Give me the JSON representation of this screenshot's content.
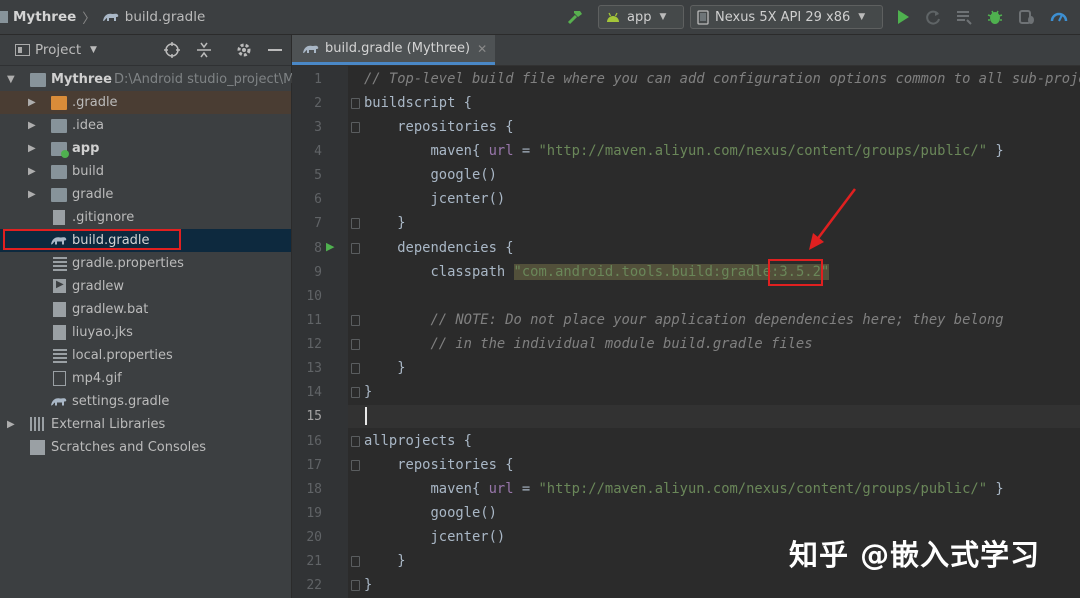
{
  "breadcrumb": {
    "project": "Mythree",
    "file": "build.gradle"
  },
  "toolbar": {
    "run_config": "app",
    "device": "Nexus 5X API 29 x86"
  },
  "project_panel": {
    "view_label": "Project",
    "root": {
      "name": "Mythree",
      "path": "D:\\Android studio_project\\M"
    },
    "items": [
      {
        "label": ".gradle"
      },
      {
        "label": ".idea"
      },
      {
        "label": "app"
      },
      {
        "label": "build"
      },
      {
        "label": "gradle"
      },
      {
        "label": ".gitignore"
      },
      {
        "label": "build.gradle"
      },
      {
        "label": "gradle.properties"
      },
      {
        "label": "gradlew"
      },
      {
        "label": "gradlew.bat"
      },
      {
        "label": "liuyao.jks"
      },
      {
        "label": "local.properties"
      },
      {
        "label": "mp4.gif"
      },
      {
        "label": "settings.gradle"
      }
    ],
    "external_libraries": "External Libraries",
    "scratches": "Scratches and Consoles"
  },
  "editor": {
    "tab_label": "build.gradle (Mythree)",
    "line_numbers": [
      "1",
      "2",
      "3",
      "4",
      "5",
      "6",
      "7",
      "8",
      "9",
      "10",
      "11",
      "12",
      "13",
      "14",
      "15",
      "16",
      "17",
      "18",
      "19",
      "20",
      "21",
      "22"
    ],
    "lines": {
      "l1": "// Top-level build file where you can add configuration options common to all sub-projec",
      "l2": "buildscript {",
      "l3": "    repositories {",
      "l4a": "        maven{ ",
      "l4b": "url",
      "l4c": " = ",
      "l4d": "\"http://maven.aliyun.com/nexus/content/groups/public/\"",
      "l4e": " }",
      "l5": "        google()",
      "l6": "        jcenter()",
      "l7": "    }",
      "l8": "    dependencies {",
      "l9a": "        classpath ",
      "l9b": "\"com.android.tools.build:gradle:3.5.2\"",
      "l11": "        // NOTE: Do not place your application dependencies here; they belong",
      "l12": "        // in the individual module build.gradle files",
      "l13": "    }",
      "l14": "}",
      "l16": "allprojects {",
      "l17": "    repositories {",
      "l18a": "        maven{ ",
      "l18b": "url",
      "l18c": " = ",
      "l18d": "\"http://maven.aliyun.com/nexus/content/groups/public/\"",
      "l18e": " }",
      "l19": "        google()",
      "l20": "        jcenter()",
      "l21": "    }",
      "l22": "}"
    }
  },
  "watermark": "知乎 @嵌入式学习",
  "colors": {
    "accent": "#4a88c7",
    "annotation_red": "#e02020",
    "android_green": "#a4c639"
  }
}
